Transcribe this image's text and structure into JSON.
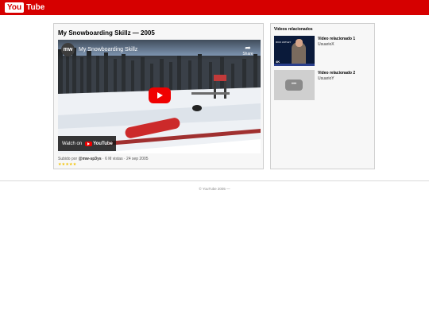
{
  "header": {
    "logo_you": "You",
    "logo_tube": "Tube"
  },
  "video": {
    "title": "My Snowboarding Skillz — 2005",
    "player_title": "My Snowboarding Skillz",
    "channel_initials": "mw",
    "share_label": "Share",
    "watch_on_label": "Watch on",
    "watch_on_brand": "YouTube",
    "meta_prefix": "Subido por",
    "uploader": "@mw-sp3ys",
    "meta_suffix": "· 6 M vistas · 24 sep 2005",
    "rating": "★★★★★",
    "rating_value": 5
  },
  "sidebar": {
    "heading": "Videos relacionados",
    "items": [
      {
        "title": "Video relacionado 1",
        "user": "UsuarioX",
        "thumb_text": "RICK ASTLEY",
        "thumb_badge": "4K"
      },
      {
        "title": "Video relacionado 2",
        "user": "UsuarioY",
        "thumb_text": "•••"
      }
    ]
  },
  "footer": {
    "text": "© YouTube 2005 —"
  },
  "colors": {
    "brand_red": "#d60000",
    "play_red": "#f00000",
    "star_yellow": "#f2c200"
  },
  "icons": {
    "share": "share-icon",
    "play": "play-icon",
    "more": "ellipsis-icon"
  }
}
